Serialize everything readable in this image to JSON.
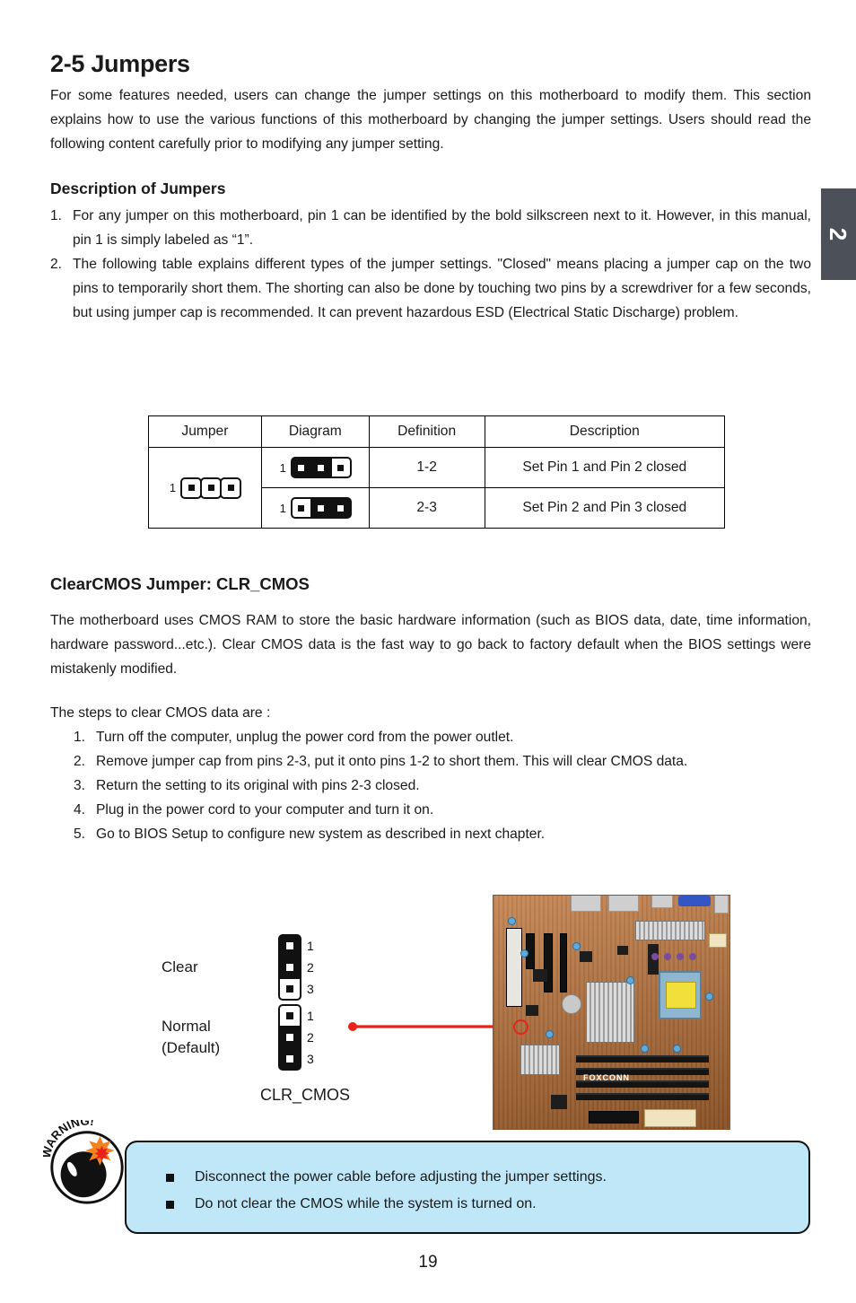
{
  "chapter_tab": {
    "number": "2"
  },
  "page": {
    "number": "19"
  },
  "section": {
    "title": "2-5 Jumpers",
    "intro": "For some features needed, users can change the jumper settings on this motherboard to modify them. This section explains how to use the various functions of this motherboard by changing the jumper settings. Users should read the following content carefully prior to modifying any jumper setting."
  },
  "description": {
    "heading": "Description of Jumpers",
    "items": [
      {
        "marker": "1.",
        "text": "For any jumper on this motherboard, pin 1 can be identified by the bold silkscreen next to it. However, in this manual, pin 1 is simply labeled as “1”."
      },
      {
        "marker": "2.",
        "text": "The following table explains different types of the jumper settings. \"Closed\" means placing a jumper cap on the two pins to temporarily short them. The shorting can also be done by touching two pins by a screwdriver for a few seconds, but using jumper cap is recommended. It can prevent hazardous ESD (Electrical Static Discharge) problem."
      }
    ]
  },
  "jumper_table": {
    "headers": [
      "Jumper",
      "Diagram",
      "Definition",
      "Description"
    ],
    "jumper_pin_label": "1",
    "rows": [
      {
        "pin_label": "1",
        "pins_closed": [
          true,
          true,
          false
        ],
        "definition": "1-2",
        "description": "Set Pin 1 and Pin 2 closed"
      },
      {
        "pin_label": "1",
        "pins_closed": [
          false,
          true,
          true
        ],
        "definition": "2-3",
        "description": "Set Pin 2 and Pin 3 closed"
      }
    ]
  },
  "clearcmos": {
    "heading": "ClearCMOS Jumper: CLR_CMOS",
    "paragraph": "The motherboard uses CMOS RAM to store the basic hardware information (such as BIOS data, date, time information, hardware password...etc.). Clear CMOS data is the fast way to go back to factory default when the BIOS settings were mistakenly modified.",
    "steps_intro": "The steps to clear CMOS data are :",
    "steps": [
      {
        "marker": "1.",
        "text": "Turn off the computer, unplug the power cord from the power outlet."
      },
      {
        "marker": "2.",
        "text": "Remove jumper cap from pins 2-3, put it onto pins 1-2 to short them. This will clear CMOS data."
      },
      {
        "marker": "3.",
        "text": "Return the setting to its original with pins 2-3 closed."
      },
      {
        "marker": "4.",
        "text": "Plug in the power cord to your computer and turn it on."
      },
      {
        "marker": "5.",
        "text": "Go to BIOS Setup to configure new system as described in next chapter."
      }
    ]
  },
  "cmos_diagram": {
    "clear": {
      "label": "Clear",
      "pin_numbers": [
        "1",
        "2",
        "3"
      ],
      "pins_closed": [
        true,
        true,
        false
      ]
    },
    "normal": {
      "label_line1": "Normal",
      "label_line2": "(Default)",
      "pin_numbers": [
        "1",
        "2",
        "3"
      ],
      "pins_closed": [
        false,
        true,
        true
      ]
    },
    "connector_name": "CLR_CMOS",
    "pointer_color": "#e8231a"
  },
  "board_photo": {
    "brand": "FOXCONN",
    "highlight_color": "#e8231a"
  },
  "warning": {
    "badge_text": "WARNING!",
    "box_color": "#bfe7f7",
    "items": [
      "Disconnect the power cable before adjusting the jumper settings.",
      "Do not clear the CMOS while the system is turned on."
    ]
  }
}
